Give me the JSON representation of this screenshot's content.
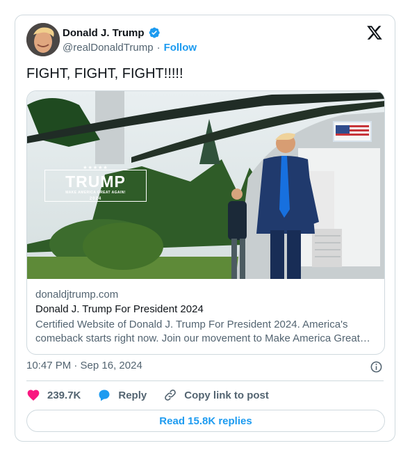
{
  "author": {
    "name": "Donald J. Trump",
    "handle": "@realDonaldTrump",
    "separator": "·",
    "follow_label": "Follow"
  },
  "tweet": {
    "text": "FIGHT, FIGHT, FIGHT!!!!!",
    "timestamp": "10:47 PM · Sep 16, 2024"
  },
  "media_sign": {
    "stars": "★★★★★",
    "title": "TRUMP",
    "slogan": "MAKE AMERICA GREAT AGAIN!",
    "year": "2024"
  },
  "link_card": {
    "domain": "donaldjtrump.com",
    "title": "Donald J. Trump For President 2024",
    "description": "Certified Website of Donald J. Trump For President 2024. America's comeback starts right now. Join our movement to Make America Great Again!"
  },
  "actions": {
    "likes": "239.7K",
    "reply_label": "Reply",
    "copy_link_label": "Copy link to post",
    "read_replies_label": "Read 15.8K replies"
  },
  "icons": {
    "verified": "verified-badge-icon",
    "logo": "x-logo-icon",
    "info": "info-icon",
    "like": "heart-icon",
    "reply": "speech-bubble-icon",
    "copy": "link-icon"
  },
  "colors": {
    "accent": "#1d9bf0",
    "heart": "#f91880",
    "text": "#0f1419",
    "muted": "#536471",
    "border": "#cfd9de"
  }
}
